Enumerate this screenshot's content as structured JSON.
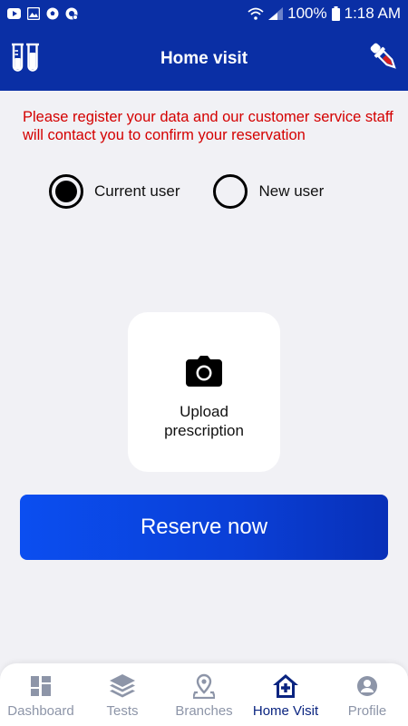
{
  "status_bar": {
    "battery": "100%",
    "time": "1:18 AM",
    "icons": [
      "youtube-icon",
      "gallery-icon",
      "soccer-ball-icon",
      "whatsapp-icon",
      "wifi-icon",
      "signal-icon",
      "battery-icon"
    ]
  },
  "header": {
    "title": "Home visit",
    "left_icon": "test-tubes-icon",
    "right_icon": "dropper-icon"
  },
  "notice": {
    "text": "Please register your data  and our customer service staff will contact  you to confirm your reservation"
  },
  "user_type": {
    "options": [
      {
        "label": "Current user",
        "selected": true
      },
      {
        "label": "New user",
        "selected": false
      }
    ]
  },
  "upload": {
    "icon": "camera-icon",
    "label": "Upload\nprescription"
  },
  "reserve": {
    "label": "Reserve now"
  },
  "nav": {
    "items": [
      {
        "label": "Dashboard",
        "icon": "dashboard-icon",
        "active": false
      },
      {
        "label": "Tests",
        "icon": "layers-icon",
        "active": false
      },
      {
        "label": "Branches",
        "icon": "location-pin-icon",
        "active": false
      },
      {
        "label": "Home Visit",
        "icon": "home-plus-icon",
        "active": true
      },
      {
        "label": "Profile",
        "icon": "profile-icon",
        "active": false
      }
    ]
  },
  "colors": {
    "primary": "#0a2fa5",
    "notice_red": "#d40000",
    "button_blue": "#0b4ef0",
    "nav_inactive": "#8d95a8",
    "nav_active": "#0a2480",
    "background": "#f1f1f5"
  }
}
